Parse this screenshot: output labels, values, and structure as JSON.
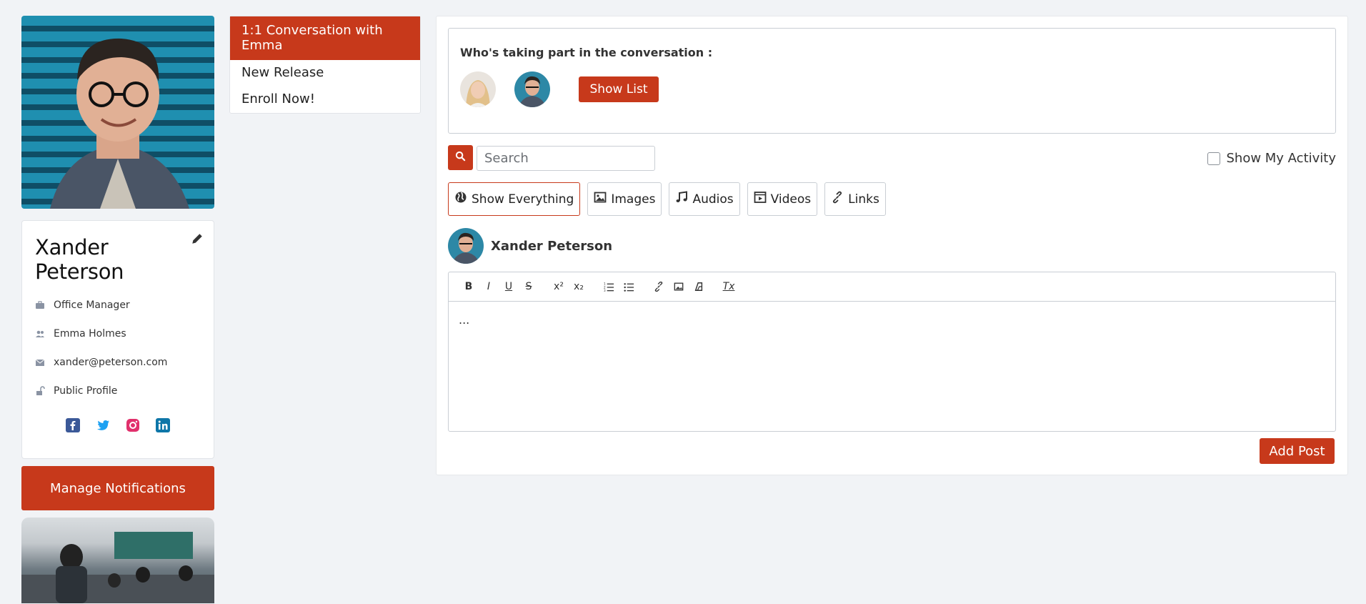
{
  "profile": {
    "name": "Xander Peterson",
    "info": [
      {
        "icon": "briefcase-icon",
        "text": "Office Manager"
      },
      {
        "icon": "users-icon",
        "text": "Emma Holmes"
      },
      {
        "icon": "envelope-icon",
        "text": "xander@peterson.com"
      },
      {
        "icon": "unlock-icon",
        "text": "Public Profile"
      }
    ],
    "social": [
      "facebook-icon",
      "twitter-icon",
      "instagram-icon",
      "linkedin-icon"
    ],
    "manage_label": "Manage Notifications"
  },
  "nav": {
    "items": [
      {
        "label": "1:1 Conversation with Emma",
        "active": true
      },
      {
        "label": "New Release",
        "active": false
      },
      {
        "label": "Enroll Now!",
        "active": false
      }
    ]
  },
  "participants": {
    "title": "Who's taking part in the conversation :",
    "show_list_label": "Show List"
  },
  "search": {
    "placeholder": "Search"
  },
  "activity_label": "Show My Activity",
  "filters": [
    {
      "label": "Show Everything",
      "icon": "globe-icon",
      "active": true
    },
    {
      "label": "Images",
      "icon": "image-icon",
      "active": false
    },
    {
      "label": "Audios",
      "icon": "music-icon",
      "active": false
    },
    {
      "label": "Videos",
      "icon": "film-icon",
      "active": false
    },
    {
      "label": "Links",
      "icon": "link-icon",
      "active": false
    }
  ],
  "post": {
    "author": "Xander Peterson",
    "body": "...",
    "add_label": "Add Post"
  },
  "toolbar": {
    "bold": "B",
    "italic": "I",
    "underline": "U",
    "strike": "S",
    "superscript": "x²",
    "subscript": "x₂",
    "clear_format": "Tx"
  },
  "colors": {
    "accent": "#c7391b",
    "facebook": "#3b5998",
    "twitter": "#1da1f2",
    "instagram": "#e1306c",
    "linkedin": "#0e76a8"
  }
}
